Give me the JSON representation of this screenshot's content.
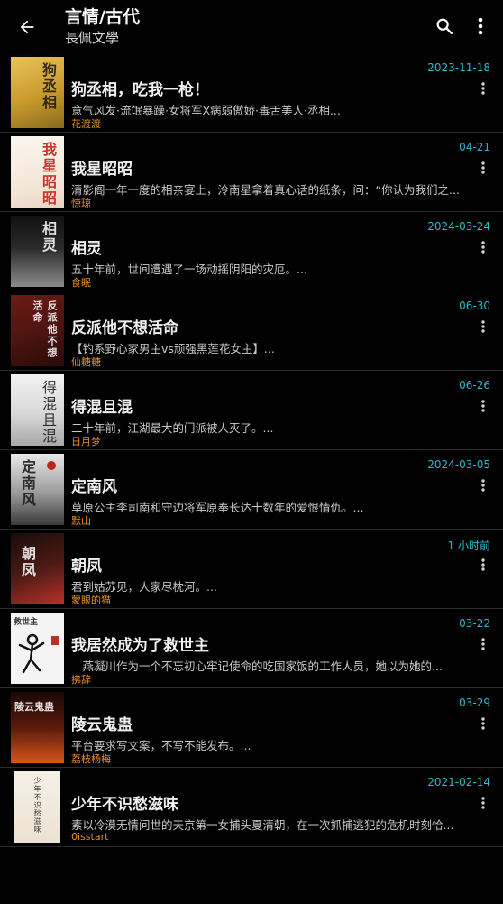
{
  "header": {
    "title": "言情/古代",
    "subtitle": "長佩文學"
  },
  "colors": {
    "accent_date": "#2eb8c9",
    "author": "#e8902a",
    "background": "#000000"
  },
  "books": [
    {
      "title": "狗丞相，吃我一枪！",
      "desc": "意气风发·流氓暴躁·女将军X病弱傲娇·毒舌美人·丞相...",
      "author": "花渡渡",
      "date": "2023-11-18",
      "cover_text": "狗丞相"
    },
    {
      "title": "我星昭昭",
      "desc": "清影阁一年一度的相亲宴上，泠南星拿着真心话的纸条，问：“你认为我们之...",
      "author": "惊琼",
      "date": "04-21",
      "cover_text": "我星昭昭"
    },
    {
      "title": "相灵",
      "desc": "五十年前，世间遭遇了一场动摇阴阳的灾厄。...",
      "author": "食眠",
      "date": "2024-03-24",
      "cover_text": "相灵"
    },
    {
      "title": "反派他不想活命",
      "desc": "【钓系野心家男主vs顽强黑莲花女主】...",
      "author": "仙糖糖",
      "date": "06-30",
      "cover_text": "反派他不想活命"
    },
    {
      "title": "得混且混",
      "desc": "二十年前，江湖最大的门派被人灭了。...",
      "author": "日月梦",
      "date": "06-26",
      "cover_text": "得混且混"
    },
    {
      "title": "定南风",
      "desc": "草原公主李司南和守边将军原奉长达十数年的爱恨情仇。...",
      "author": "默山",
      "date": "2024-03-05",
      "cover_text": "定南风"
    },
    {
      "title": "朝凤",
      "desc": "君到姑苏见，人家尽枕河。...",
      "author": "蒙眼的猫",
      "date": "1 小时前",
      "cover_text": "朝凤"
    },
    {
      "title": "我居然成为了救世主",
      "desc": "　燕凝川作为一个不忘初心牢记使命的吃国家饭的工作人员，她以为她的...",
      "author": "拂辞",
      "date": "03-22",
      "cover_text": "救世主"
    },
    {
      "title": "陵云鬼蛊",
      "desc": "平台要求写文案，不写不能发布。...",
      "author": "荔枝杨梅",
      "date": "03-29",
      "cover_text": "陵云鬼蛊"
    },
    {
      "title": "少年不识愁滋味",
      "desc": "素以冷漠无情问世的天京第一女捕头夏清朝，在一次抓捕逃犯的危机时刻恰...",
      "author": "0isstart",
      "date": "2021-02-14",
      "cover_text": "少年不识愁滋味"
    }
  ]
}
